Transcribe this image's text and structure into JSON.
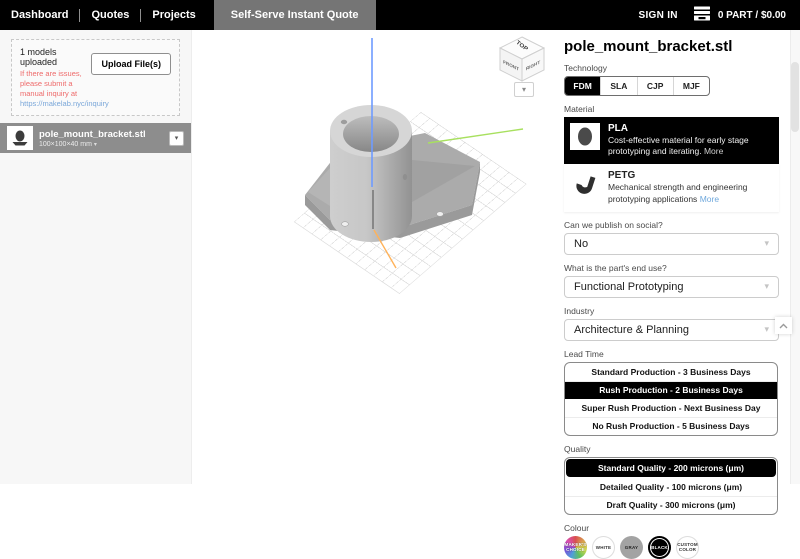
{
  "navbar": {
    "items": [
      {
        "label": "Dashboard"
      },
      {
        "label": "Quotes"
      },
      {
        "label": "Projects"
      }
    ],
    "active_tab": "Self-Serve Instant Quote",
    "sign_in": "SIGN IN",
    "cart_summary": "0 PART / $0.00"
  },
  "sidebar": {
    "upload_status": "1 models uploaded",
    "issue_note": "If there are issues, please submit a manual inquiry at",
    "issue_link": "https://makelab.nyc/inquiry",
    "upload_button": "Upload File(s)",
    "model": {
      "filename": "pole_mount_bracket.stl",
      "dimensions": "100×100×40",
      "units": "mm"
    }
  },
  "viewport": {
    "view_cube": {
      "top": "TOP",
      "front": "FRONT",
      "right": "RIGHT"
    }
  },
  "panel": {
    "title": "pole_mount_bracket.stl",
    "technology": {
      "label": "Technology",
      "options": [
        "FDM",
        "SLA",
        "CJP",
        "MJF"
      ],
      "selected": "FDM"
    },
    "material": {
      "label": "Material",
      "options": [
        {
          "name": "PLA",
          "description": "Cost-effective material for early stage prototyping and iterating.",
          "more": "More",
          "selected": true
        },
        {
          "name": "PETG",
          "description": "Mechanical strength and engineering prototyping applications",
          "more": "More",
          "selected": false
        }
      ]
    },
    "selects": [
      {
        "label": "Can we publish on social?",
        "value": "No"
      },
      {
        "label": "What is the part's end use?",
        "value": "Functional Prototyping"
      },
      {
        "label": "Industry",
        "value": "Architecture & Planning"
      }
    ],
    "lead_time": {
      "label": "Lead Time",
      "options": [
        "Standard Production - 3 Business Days",
        "Rush Production - 2 Business Days",
        "Super Rush Production - Next Business Day",
        "No Rush Production - 5 Business Days"
      ],
      "selected": "Rush Production - 2 Business Days"
    },
    "quality": {
      "label": "Quality",
      "options": [
        "Standard Quality - 200 microns (μm)",
        "Detailed Quality - 100 microns (μm)",
        "Draft Quality - 300 microns (μm)"
      ],
      "selected": "Standard Quality - 200 microns (μm)"
    },
    "colour": {
      "label": "Colour",
      "swatches": [
        {
          "label": "MAKER'S CHOICE"
        },
        {
          "label": "WHITE"
        },
        {
          "label": "GRAY"
        },
        {
          "label": "BLACK",
          "selected": true
        },
        {
          "label": "CUSTOM COLOR"
        }
      ]
    }
  },
  "icons": {
    "caret_down": "▾"
  },
  "colors": {
    "nav_bg": "#000000",
    "nav_active_bg": "#757575",
    "model_row_bg": "#8d8d8d",
    "error_red": "#ee6a6a",
    "link_blue": "#6fa8dc",
    "axis_z": "#6e9bff",
    "axis_x": "#a8e05f",
    "axis_y": "#ffb259",
    "selected_bg": "#000000"
  }
}
